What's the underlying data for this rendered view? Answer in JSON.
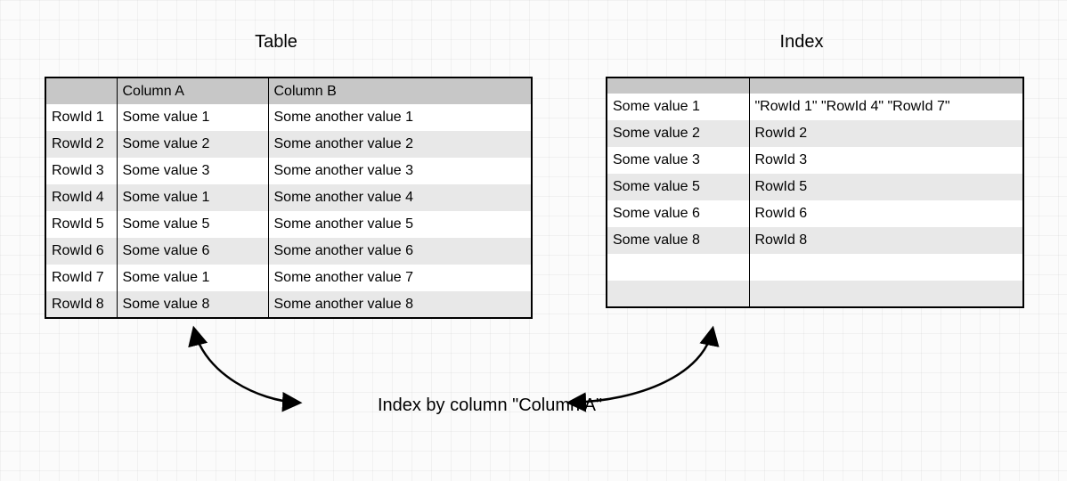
{
  "titles": {
    "left": "Table",
    "right": "Index"
  },
  "left_table": {
    "headers": [
      "",
      "Column A",
      "Column B"
    ],
    "rows": [
      [
        "RowId 1",
        "Some value 1",
        "Some another value 1"
      ],
      [
        "RowId 2",
        "Some value 2",
        "Some another value 2"
      ],
      [
        "RowId 3",
        "Some value 3",
        "Some another value 3"
      ],
      [
        "RowId 4",
        "Some value 1",
        "Some another value 4"
      ],
      [
        "RowId 5",
        "Some value 5",
        "Some another value 5"
      ],
      [
        "RowId 6",
        "Some value 6",
        "Some another value 6"
      ],
      [
        "RowId 7",
        "Some value 1",
        "Some another value 7"
      ],
      [
        "RowId 8",
        "Some value 8",
        "Some another value 8"
      ]
    ]
  },
  "right_table": {
    "rows": [
      [
        "Some value 1",
        "\"RowId 1\" \"RowId 4\" \"RowId 7\""
      ],
      [
        "Some value 2",
        "RowId 2"
      ],
      [
        "Some value 3",
        "RowId 3"
      ],
      [
        "Some value 5",
        "RowId 5"
      ],
      [
        "Some value 6",
        "RowId 6"
      ],
      [
        "Some value 8",
        "RowId 8"
      ],
      [
        "",
        ""
      ],
      [
        "",
        ""
      ]
    ]
  },
  "caption": "Index by column \"Column A\""
}
